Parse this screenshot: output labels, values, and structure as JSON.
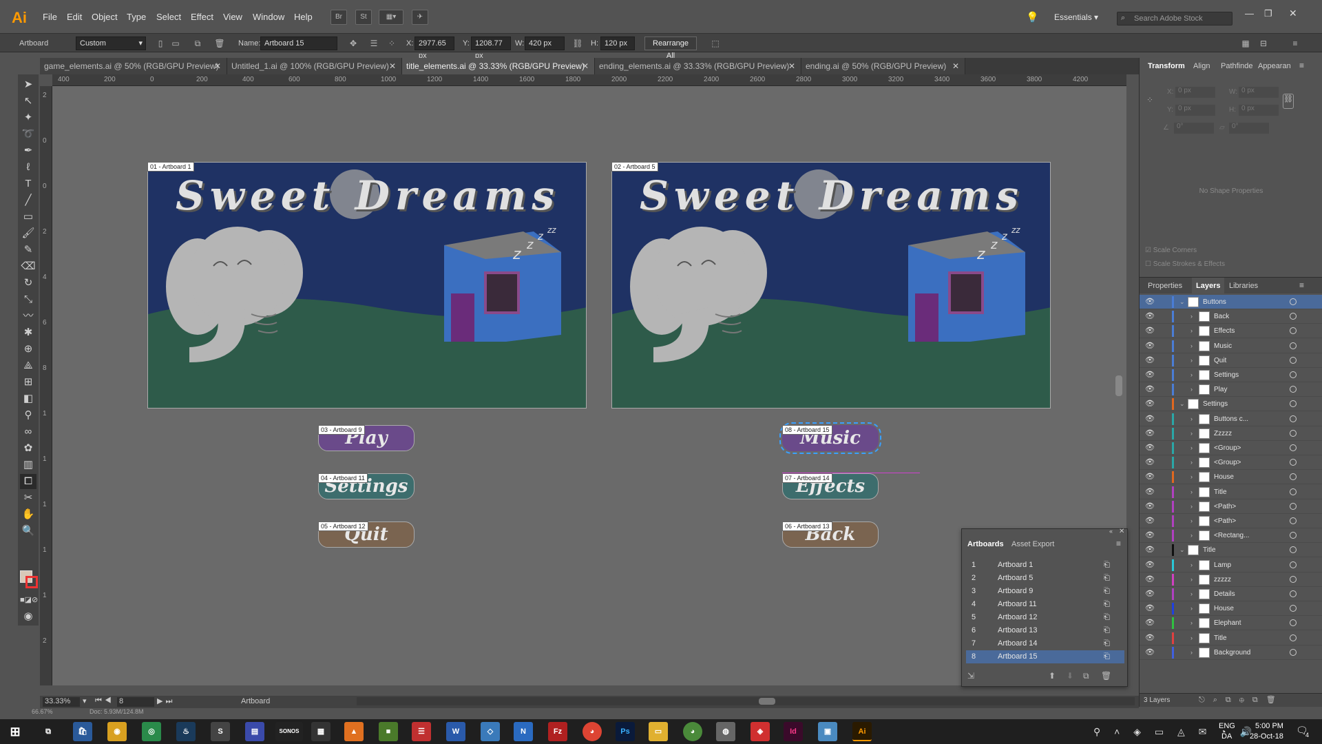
{
  "app": {
    "logo": "Ai"
  },
  "menus": [
    "File",
    "Edit",
    "Object",
    "Type",
    "Select",
    "Effect",
    "View",
    "Window",
    "Help"
  ],
  "menubar": {
    "br": "Br",
    "st": "St",
    "workspace": "Essentials",
    "search_placeholder": "Search Adobe Stock"
  },
  "control": {
    "tool_label": "Artboard",
    "preset": "Custom",
    "name_label": "Name:",
    "name_value": "Artboard 15",
    "x_label": "X:",
    "x_value": "2977.65 px",
    "y_label": "Y:",
    "y_value": "1208.77 px",
    "w_label": "W:",
    "w_value": "420 px",
    "h_label": "H:",
    "h_value": "120 px",
    "rearrange": "Rearrange All"
  },
  "tabs": [
    {
      "label": "game_elements.ai @ 50% (RGB/GPU Preview)"
    },
    {
      "label": "Untitled_1.ai @ 100% (RGB/GPU Preview)"
    },
    {
      "label": "title_elements.ai @ 33.33% (RGB/GPU Preview)"
    },
    {
      "label": "ending_elements.ai @ 33.33% (RGB/GPU Preview)"
    },
    {
      "label": "ending.ai @ 50% (RGB/GPU Preview)"
    }
  ],
  "ruler_h": [
    "400",
    "200",
    "0",
    "200",
    "400",
    "600",
    "800",
    "1000",
    "1200",
    "1400",
    "1600",
    "1800",
    "2000",
    "2200",
    "2400",
    "2600",
    "2800",
    "3000",
    "3200",
    "3400",
    "3600",
    "3800",
    "4200"
  ],
  "ruler_v": [
    "2",
    "0",
    "0",
    "2",
    "4",
    "6",
    "8",
    "1",
    "1",
    "1",
    "1",
    "1",
    "2"
  ],
  "artboards": [
    {
      "label": "01 - Artboard 1",
      "title": "Sweet Dreams"
    },
    {
      "label": "02 - Artboard 5",
      "title": "Sweet Dreams"
    },
    {
      "label": "03 - Artboard 9",
      "text": "Play"
    },
    {
      "label": "04 - Artboard 11",
      "text": "Settings"
    },
    {
      "label": "05 - Artboard 12",
      "text": "Quit"
    },
    {
      "label": "08 - Artboard 15",
      "text": "Music"
    },
    {
      "label": "07 - Artboard 14",
      "text": "Effects"
    },
    {
      "label": "06 - Artboard 13",
      "text": "Back"
    }
  ],
  "right_tabs_top": [
    "Transform",
    "Align",
    "Pathfinde",
    "Appearan"
  ],
  "transform": {
    "x": "X:",
    "y": "Y:",
    "w": "W:",
    "h": "H:",
    "xv": "0 px",
    "yv": "0 px",
    "wv": "0 px",
    "hv": "0 px",
    "angle": "0°",
    "shear": "0°",
    "no_shape": "No Shape Properties",
    "scale_corners": "Scale Corners",
    "scale_strokes": "Scale Strokes & Effects"
  },
  "right_tabs_mid": [
    "Properties",
    "Layers",
    "Libraries"
  ],
  "layers": [
    {
      "name": "Buttons",
      "level": 0,
      "color": "#4a7dd6"
    },
    {
      "name": "Back",
      "level": 1,
      "color": "#4a7dd6"
    },
    {
      "name": "Effects",
      "level": 1,
      "color": "#4a7dd6"
    },
    {
      "name": "Music",
      "level": 1,
      "color": "#4a7dd6"
    },
    {
      "name": "Quit",
      "level": 1,
      "color": "#4a7dd6"
    },
    {
      "name": "Settings",
      "level": 1,
      "color": "#4a7dd6"
    },
    {
      "name": "Play",
      "level": 1,
      "color": "#4a7dd6"
    },
    {
      "name": "Settings",
      "level": 0,
      "color": "#e06820"
    },
    {
      "name": "Buttons c...",
      "level": 1,
      "color": "#2aa7a7"
    },
    {
      "name": "Zzzzz",
      "level": 1,
      "color": "#2aa7a7"
    },
    {
      "name": "<Group>",
      "level": 1,
      "color": "#2aa7a7"
    },
    {
      "name": "<Group>",
      "level": 1,
      "color": "#2aa7a7"
    },
    {
      "name": "House",
      "level": 1,
      "color": "#e06820"
    },
    {
      "name": "Title",
      "level": 1,
      "color": "#b040c0"
    },
    {
      "name": "<Path>",
      "level": 1,
      "color": "#b040c0"
    },
    {
      "name": "<Path>",
      "level": 1,
      "color": "#b040c0"
    },
    {
      "name": "<Rectang...",
      "level": 1,
      "color": "#b040c0"
    },
    {
      "name": "Title",
      "level": 0,
      "color": "#111111"
    },
    {
      "name": "Lamp",
      "level": 1,
      "color": "#2ac8d8"
    },
    {
      "name": "zzzzz",
      "level": 1,
      "color": "#d040c0"
    },
    {
      "name": "Details",
      "level": 1,
      "color": "#b040c0"
    },
    {
      "name": "House",
      "level": 1,
      "color": "#2040e0"
    },
    {
      "name": "Elephant",
      "level": 1,
      "color": "#30c040"
    },
    {
      "name": "Title",
      "level": 1,
      "color": "#e04040"
    },
    {
      "name": "Background",
      "level": 1,
      "color": "#4060e0"
    }
  ],
  "layers_footer": "3 Layers",
  "ab_panel": {
    "tabs": [
      "Artboards",
      "Asset Export"
    ],
    "rows": [
      {
        "num": "1",
        "name": "Artboard 1"
      },
      {
        "num": "2",
        "name": "Artboard 5"
      },
      {
        "num": "3",
        "name": "Artboard 9"
      },
      {
        "num": "4",
        "name": "Artboard 11"
      },
      {
        "num": "5",
        "name": "Artboard 12"
      },
      {
        "num": "6",
        "name": "Artboard 13"
      },
      {
        "num": "7",
        "name": "Artboard 14"
      },
      {
        "num": "8",
        "name": "Artboard 15"
      }
    ]
  },
  "status": {
    "zoom": "33.33%",
    "page": "8",
    "tool": "Artboard",
    "zoom2": "66.67%",
    "doc": "Doc: 5.93M/124.8M"
  },
  "taskbar": {
    "lang1": "ENG",
    "lang2": "DA",
    "time": "5:00 PM",
    "date": "28-Oct-18",
    "notif": "4"
  },
  "colors": {
    "sky": "#1f3264",
    "grass": "#2e5b4a",
    "house": "#3b6fc0",
    "play": "#6a4a8a",
    "settings": "#3d6d6d",
    "quit": "#7a6450"
  }
}
